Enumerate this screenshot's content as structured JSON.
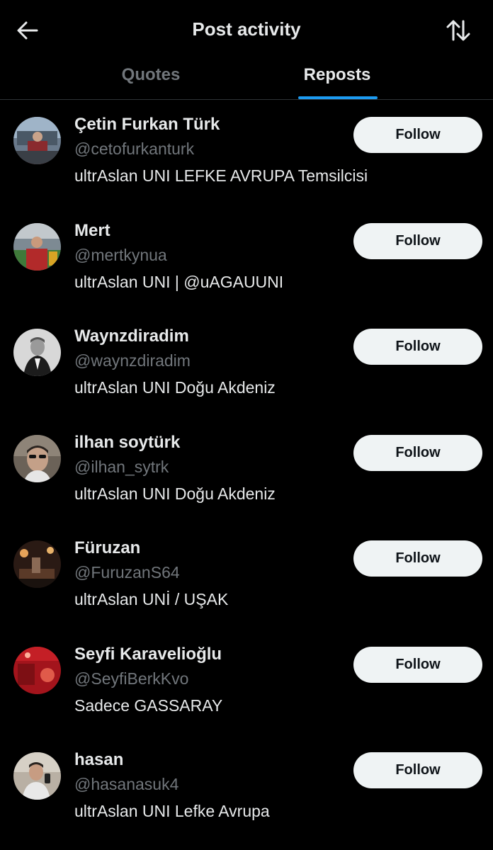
{
  "header": {
    "title": "Post activity",
    "back_icon": "arrow-left-icon",
    "sort_icon": "sort-arrows-icon"
  },
  "tabs": [
    {
      "label": "Quotes",
      "active": false
    },
    {
      "label": "Reposts",
      "active": true
    }
  ],
  "colors": {
    "background": "#000000",
    "text_primary": "#e7e9ea",
    "text_secondary": "#71767b",
    "accent": "#1d9bf0",
    "follow_button_bg": "#eff3f4",
    "follow_button_text": "#0f1419"
  },
  "users": [
    {
      "name": "Çetin Furkan Türk",
      "handle": "@cetofurkanturk",
      "bio": "ultrAslan UNI LEFKE AVRUPA Temsilcisi",
      "follow_label": "Follow"
    },
    {
      "name": "Mert",
      "handle": "@mertkynua",
      "bio": "ultrAslan UNI | @uAGAUUNI",
      "follow_label": "Follow"
    },
    {
      "name": "Waynzdiradim",
      "handle": "@waynzdiradim",
      "bio": "ultrAslan UNI Doğu Akdeniz",
      "follow_label": "Follow"
    },
    {
      "name": "ilhan soytürk",
      "handle": "@ilhan_sytrk",
      "bio": "ultrAslan UNI Doğu Akdeniz",
      "follow_label": "Follow"
    },
    {
      "name": "Füruzan",
      "handle": "@FuruzanS64",
      "bio": "ultrAslan UNİ / UŞAK",
      "follow_label": "Follow"
    },
    {
      "name": "Seyfi Karavelioğlu",
      "handle": "@SeyfiBerkKvo",
      "bio": "Sadece GASSARAY",
      "follow_label": "Follow"
    },
    {
      "name": "hasan",
      "handle": "@hasanasuk4",
      "bio": "ultrAslan UNI Lefke Avrupa",
      "follow_label": "Follow"
    }
  ]
}
